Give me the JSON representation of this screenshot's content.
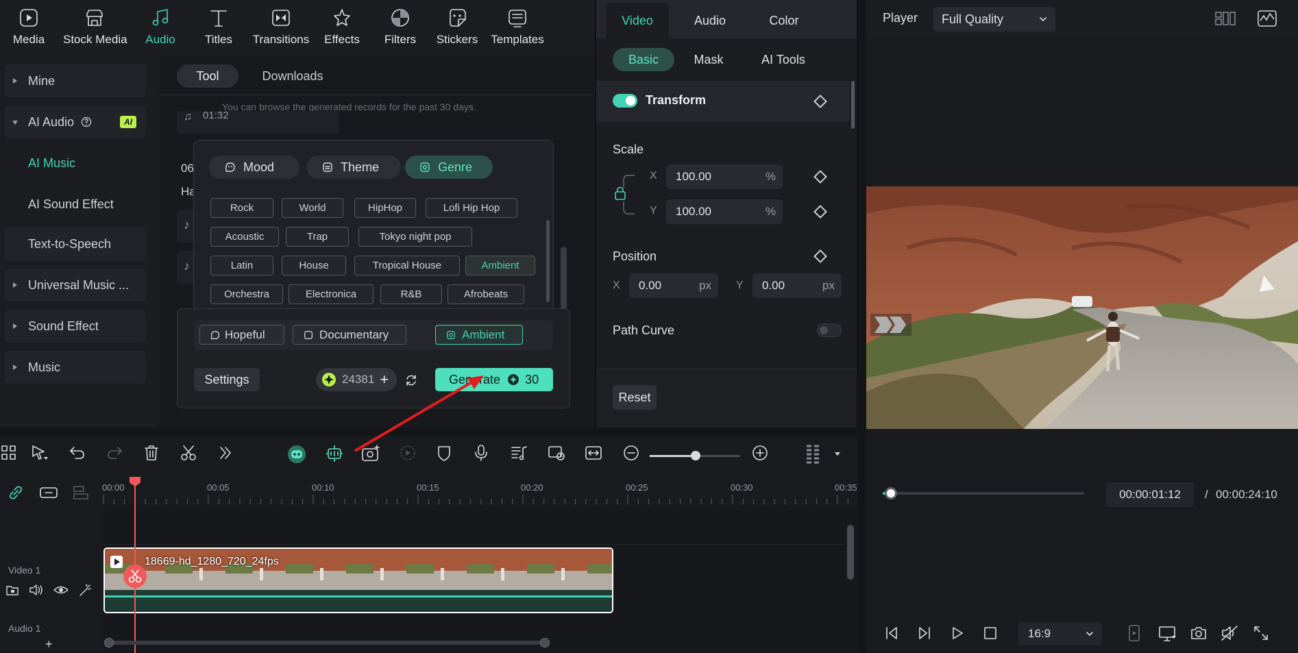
{
  "top_tabs": [
    {
      "label": "Media",
      "icon": "media-icon"
    },
    {
      "label": "Stock Media",
      "icon": "stock-media-icon"
    },
    {
      "label": "Audio",
      "icon": "music-note-icon",
      "active": true
    },
    {
      "label": "Titles",
      "icon": "text-t-icon"
    },
    {
      "label": "Transitions",
      "icon": "transitions-icon"
    },
    {
      "label": "Effects",
      "icon": "effects-icon"
    },
    {
      "label": "Filters",
      "icon": "filters-icon"
    },
    {
      "label": "Stickers",
      "icon": "stickers-icon"
    },
    {
      "label": "Templates",
      "icon": "templates-icon"
    }
  ],
  "sidebar": {
    "items": [
      {
        "label": "Mine"
      },
      {
        "label": "AI Audio",
        "badge": "AI"
      },
      {
        "label": "AI Music",
        "selected": true
      },
      {
        "label": "AI Sound Effect"
      },
      {
        "label": "Text-to-Speech"
      },
      {
        "label": "Universal Music ..."
      },
      {
        "label": "Sound Effect"
      },
      {
        "label": "Music"
      }
    ]
  },
  "mid": {
    "tabs": [
      {
        "label": "Tool"
      },
      {
        "label": "Downloads"
      }
    ],
    "info": "You can browse the generated records for the past 30 days.",
    "record_time": "01:32",
    "partial_1": "06",
    "partial_2": "Ha"
  },
  "popup": {
    "categories": [
      {
        "label": "Mood"
      },
      {
        "label": "Theme"
      },
      {
        "label": "Genre"
      }
    ],
    "genres": [
      "Rock",
      "World",
      "HipHop",
      "Lofi Hip Hop",
      "Acoustic",
      "Trap",
      "Tokyo night pop",
      "Latin",
      "House",
      "Tropical House",
      "Ambient",
      "Orchestra",
      "Electronica",
      "R&B",
      "Afrobeats"
    ],
    "selected_genre": "Ambient"
  },
  "prompt": {
    "chips": [
      "Hopeful",
      "Documentary",
      "Ambient"
    ],
    "settings_label": "Settings",
    "credits": "24381",
    "generate_label": "Generate",
    "generate_cost": "30"
  },
  "props": {
    "tabs": [
      "Video",
      "Audio",
      "Color"
    ],
    "subtabs": [
      "Basic",
      "Mask",
      "AI Tools"
    ],
    "transform_label": "Transform",
    "scale_label": "Scale",
    "scale_x": "100.00",
    "scale_y": "100.00",
    "scale_unit": "%",
    "x_label": "X",
    "y_label": "Y",
    "position_label": "Position",
    "pos_x": "0.00",
    "pos_y": "0.00",
    "pos_unit": "px",
    "path_curve_label": "Path Curve",
    "reset_label": "Reset"
  },
  "player": {
    "label": "Player",
    "quality": "Full Quality",
    "current_time": "00:00:01:12",
    "separator": "/",
    "total_time": "00:00:24:10",
    "aspect": "16:9",
    "progress": 0.04
  },
  "timeline": {
    "ruler": [
      "00:00",
      "00:05",
      "00:10",
      "00:15",
      "00:20",
      "00:25",
      "00:30",
      "00:35"
    ],
    "clip_name": "18669-hd_1280_720_24fps",
    "video_track": "Video 1",
    "audio_track": "Audio 1",
    "add_label": "+"
  },
  "colors": {
    "accent": "#43d3b4",
    "playhead": "#f05a5a",
    "annotation_arrow": "#e01e1e"
  }
}
